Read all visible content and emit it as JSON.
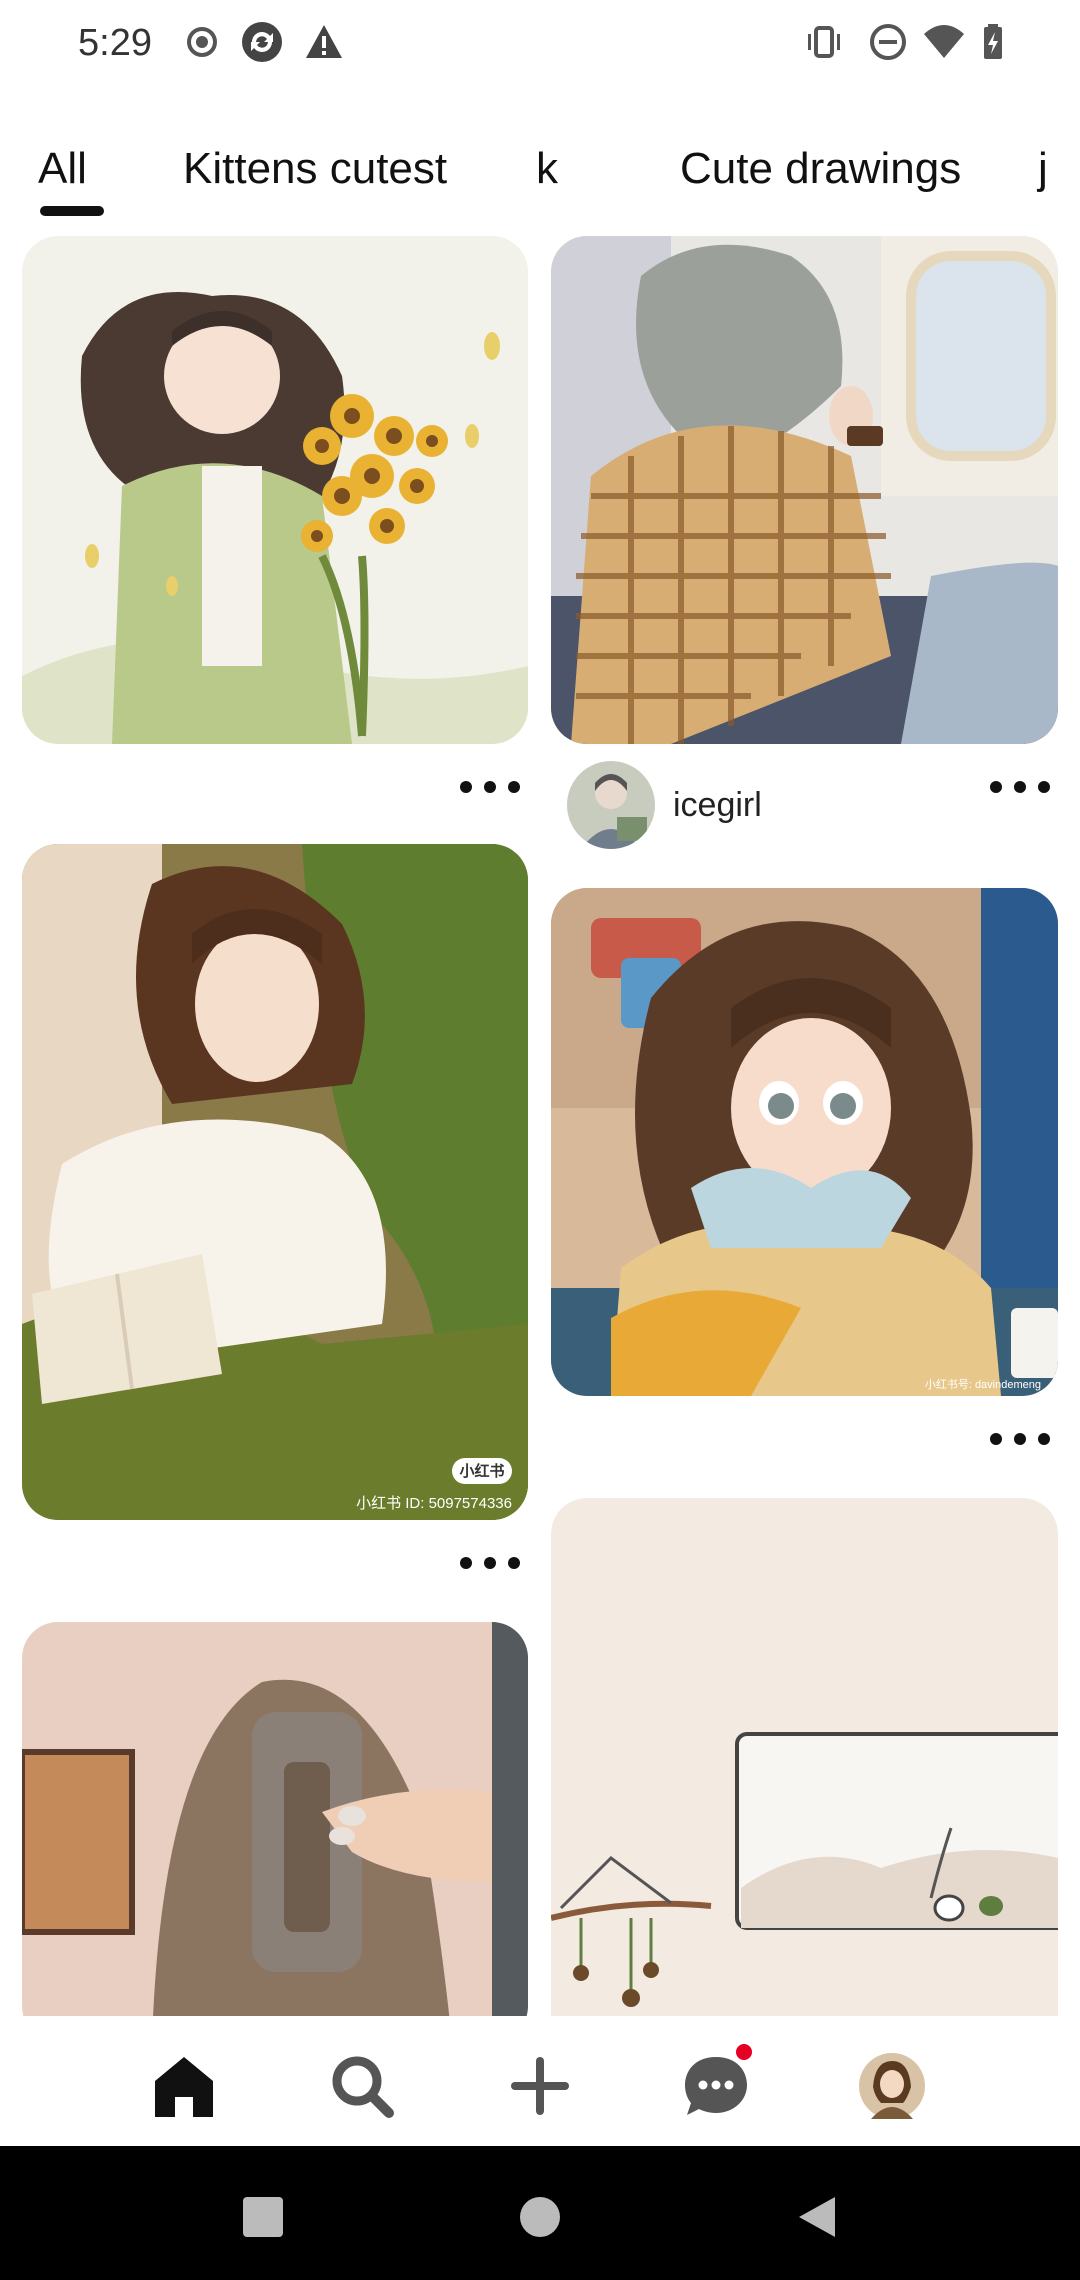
{
  "status_bar": {
    "time": "5:29",
    "left_icons": [
      "record-icon",
      "sync-icon",
      "warning-icon"
    ],
    "right_icons": [
      "vibrate-icon",
      "do-not-disturb-icon",
      "wifi-icon",
      "battery-charging-icon"
    ]
  },
  "tabs": [
    {
      "label": "All",
      "selected": true
    },
    {
      "label": "Kittens cutest",
      "selected": false
    },
    {
      "label": "k",
      "selected": false
    },
    {
      "label": "Cute drawings",
      "selected": false
    },
    {
      "label": "j",
      "selected": false
    }
  ],
  "feed": {
    "pins": [
      {
        "id": "sunflower-girl",
        "watermark": ""
      },
      {
        "id": "train-window-girl",
        "creator": "icegirl"
      },
      {
        "id": "reading-girl",
        "watermark_badge": "小红书",
        "watermark": "小红书 ID: 5097574336"
      },
      {
        "id": "cafe-girl",
        "watermark": "小红书号: davindemeng"
      },
      {
        "id": "hair-clip-photo"
      },
      {
        "id": "interior-drawing"
      }
    ]
  },
  "bottom_nav": {
    "items": [
      "home-icon",
      "search-icon",
      "create-icon",
      "messages-icon",
      "profile-avatar"
    ],
    "active": "home-icon",
    "messages_has_notification": true
  },
  "system_nav": [
    "recents-icon",
    "home-circle-icon",
    "back-icon"
  ],
  "colors": {
    "accent": "#111111",
    "notification": "#e60023",
    "system_bar": "#000000"
  }
}
